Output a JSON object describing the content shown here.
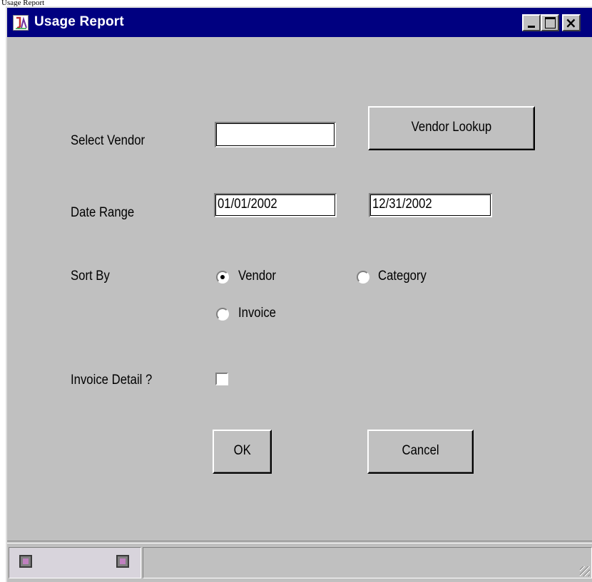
{
  "window": {
    "title": "Usage Report"
  },
  "tooltip_strip": "Usage Report",
  "form": {
    "vendor_label": "Select Vendor",
    "vendor_value": "",
    "vendor_lookup_label": "Vendor Lookup",
    "date_range_label": "Date Range",
    "date_from": "01/01/2002",
    "date_to": "12/31/2002",
    "sort_by_label": "Sort By",
    "sort_options": [
      {
        "label": "Vendor",
        "selected": true
      },
      {
        "label": "Category",
        "selected": false
      },
      {
        "label": "Invoice",
        "selected": false
      }
    ],
    "invoice_detail_label": "Invoice Detail ?",
    "invoice_detail_checked": false,
    "ok_label": "OK",
    "cancel_label": "Cancel"
  },
  "icons": {
    "app": "app-icon",
    "status_left": "computer-icon",
    "status_right": "computer-icon"
  }
}
